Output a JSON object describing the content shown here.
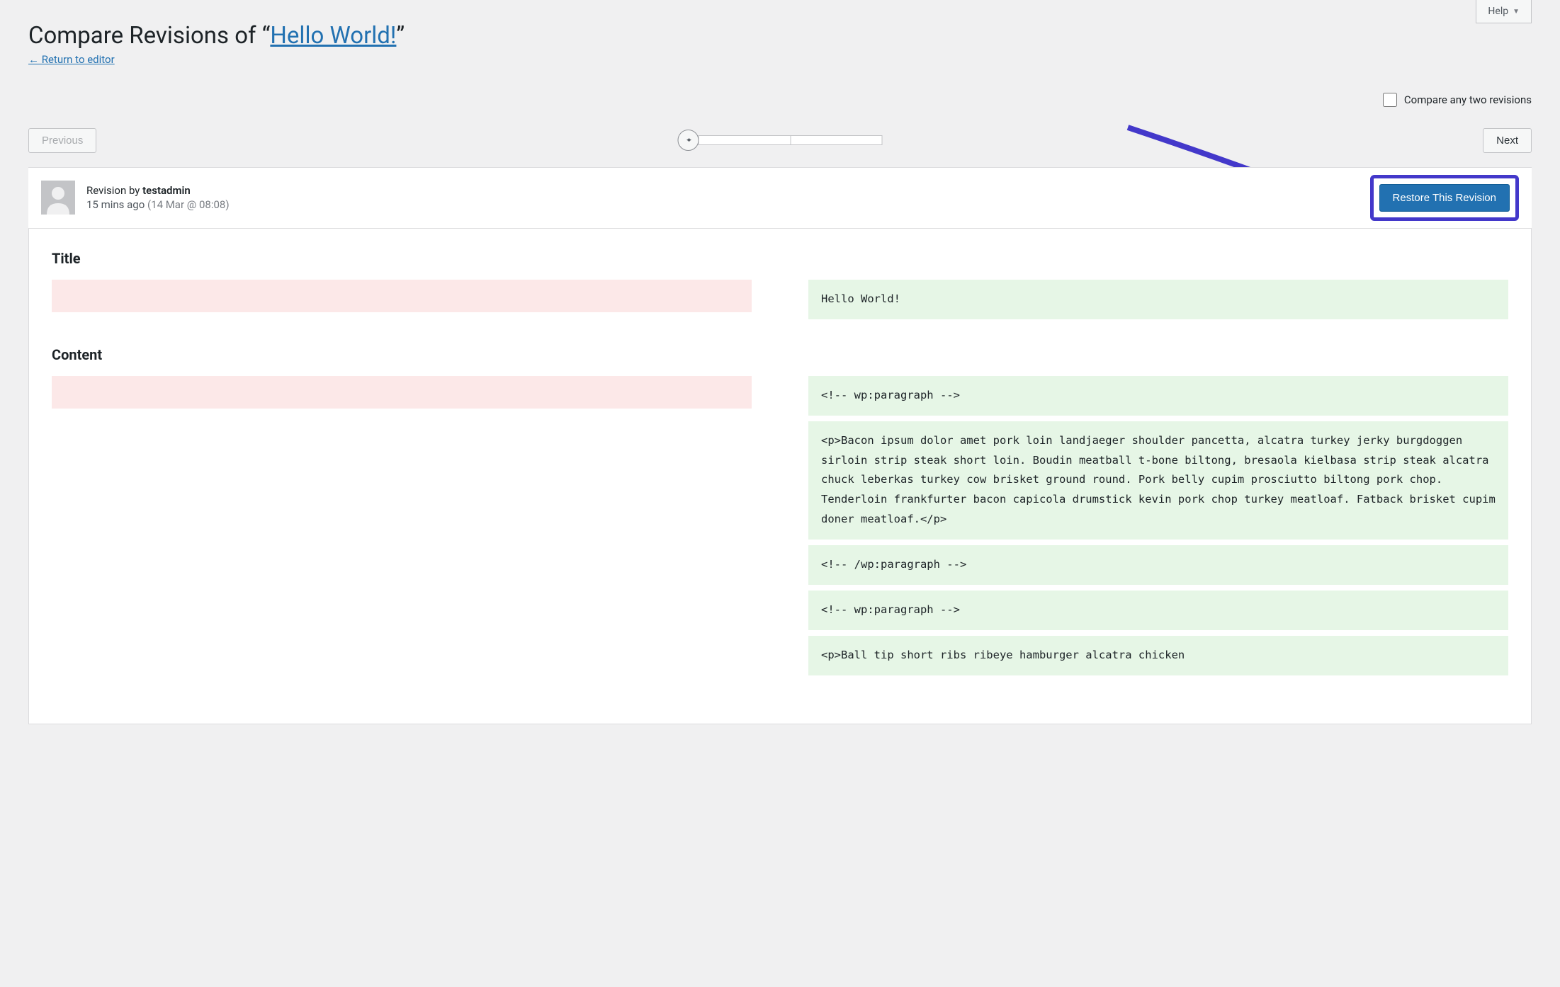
{
  "help": {
    "label": "Help"
  },
  "header": {
    "prefix": "Compare Revisions of “",
    "link_text": "Hello World!",
    "suffix": "”",
    "return_link": "← Return to editor"
  },
  "compare": {
    "label": "Compare any two revisions"
  },
  "nav": {
    "prev": "Previous",
    "next": "Next"
  },
  "revision": {
    "by_prefix": "Revision by ",
    "author": "testadmin",
    "ago": "15 mins ago",
    "datetime": "(14 Mar @ 08:08)",
    "restore": "Restore This Revision"
  },
  "diff": {
    "title_label": "Title",
    "content_label": "Content",
    "title_added": "Hello World!",
    "content_added": [
      "<!-- wp:paragraph -->",
      "<p>Bacon ipsum dolor amet pork loin landjaeger shoulder pancetta, alcatra turkey jerky burgdoggen sirloin strip steak short loin. Boudin meatball t-bone biltong, bresaola kielbasa strip steak alcatra chuck leberkas turkey cow brisket ground round. Pork belly cupim prosciutto biltong pork chop. Tenderloin frankfurter bacon capicola drumstick kevin pork chop turkey meatloaf. Fatback brisket cupim doner meatloaf.</p>",
      "<!-- /wp:paragraph -->",
      "<!-- wp:paragraph -->",
      "<p>Ball tip short ribs ribeye hamburger alcatra chicken"
    ]
  }
}
